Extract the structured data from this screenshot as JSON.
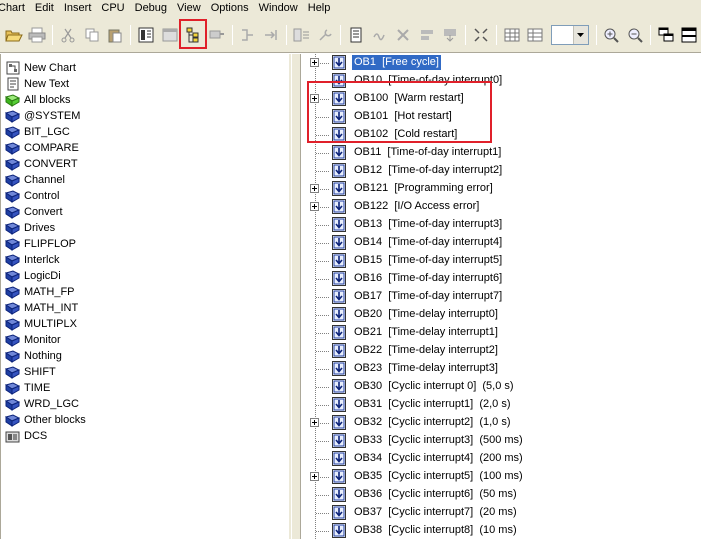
{
  "menu": [
    "Chart",
    "Edit",
    "Insert",
    "CPU",
    "Debug",
    "View",
    "Options",
    "Window",
    "Help"
  ],
  "left_tree": [
    {
      "label": "New Chart",
      "icon": "new-chart-icon"
    },
    {
      "label": "New Text",
      "icon": "new-text-icon"
    },
    {
      "label": "All blocks",
      "icon": "all-blocks-icon"
    },
    {
      "label": "@SYSTEM",
      "icon": "library-book-icon"
    },
    {
      "label": "BIT_LGC",
      "icon": "library-book-icon"
    },
    {
      "label": "COMPARE",
      "icon": "library-book-icon"
    },
    {
      "label": "CONVERT",
      "icon": "library-book-icon"
    },
    {
      "label": "Channel",
      "icon": "library-book-icon"
    },
    {
      "label": "Control",
      "icon": "library-book-icon"
    },
    {
      "label": "Convert",
      "icon": "library-book-icon"
    },
    {
      "label": "Drives",
      "icon": "library-book-icon"
    },
    {
      "label": "FLIPFLOP",
      "icon": "library-book-icon"
    },
    {
      "label": "Interlck",
      "icon": "library-book-icon"
    },
    {
      "label": "LogicDi",
      "icon": "library-book-icon"
    },
    {
      "label": "MATH_FP",
      "icon": "library-book-icon"
    },
    {
      "label": "MATH_INT",
      "icon": "library-book-icon"
    },
    {
      "label": "MULTIPLX",
      "icon": "library-book-icon"
    },
    {
      "label": "Monitor",
      "icon": "library-book-icon"
    },
    {
      "label": "Nothing",
      "icon": "library-book-icon"
    },
    {
      "label": "SHIFT",
      "icon": "library-book-icon"
    },
    {
      "label": "TIME",
      "icon": "library-book-icon"
    },
    {
      "label": "WRD_LGC",
      "icon": "library-book-icon"
    },
    {
      "label": "Other blocks",
      "icon": "library-book-icon"
    },
    {
      "label": "DCS",
      "icon": "dcs-icon"
    }
  ],
  "ob_tree": [
    {
      "label": "OB1  [Free cycle]",
      "expand": true,
      "selected": true
    },
    {
      "label": "OB10  [Time-of-day interrupt0]",
      "expand": false,
      "selected": false
    },
    {
      "label": "OB100  [Warm restart]",
      "expand": true,
      "selected": false
    },
    {
      "label": "OB101  [Hot restart]",
      "expand": false,
      "selected": false
    },
    {
      "label": "OB102  [Cold restart]",
      "expand": false,
      "selected": false
    },
    {
      "label": "OB11  [Time-of-day interrupt1]",
      "expand": false,
      "selected": false
    },
    {
      "label": "OB12  [Time-of-day interrupt2]",
      "expand": false,
      "selected": false
    },
    {
      "label": "OB121  [Programming error]",
      "expand": true,
      "selected": false
    },
    {
      "label": "OB122  [I/O Access error]",
      "expand": true,
      "selected": false
    },
    {
      "label": "OB13  [Time-of-day interrupt3]",
      "expand": false,
      "selected": false
    },
    {
      "label": "OB14  [Time-of-day interrupt4]",
      "expand": false,
      "selected": false
    },
    {
      "label": "OB15  [Time-of-day interrupt5]",
      "expand": false,
      "selected": false
    },
    {
      "label": "OB16  [Time-of-day interrupt6]",
      "expand": false,
      "selected": false
    },
    {
      "label": "OB17  [Time-of-day interrupt7]",
      "expand": false,
      "selected": false
    },
    {
      "label": "OB20  [Time-delay interrupt0]",
      "expand": false,
      "selected": false
    },
    {
      "label": "OB21  [Time-delay interrupt1]",
      "expand": false,
      "selected": false
    },
    {
      "label": "OB22  [Time-delay interrupt2]",
      "expand": false,
      "selected": false
    },
    {
      "label": "OB23  [Time-delay interrupt3]",
      "expand": false,
      "selected": false
    },
    {
      "label": "OB30  [Cyclic interrupt 0]  (5,0 s)",
      "expand": false,
      "selected": false
    },
    {
      "label": "OB31  [Cyclic interrupt1]  (2,0 s)",
      "expand": false,
      "selected": false
    },
    {
      "label": "OB32  [Cyclic interrupt2]  (1,0 s)",
      "expand": true,
      "selected": false
    },
    {
      "label": "OB33  [Cyclic interrupt3]  (500 ms)",
      "expand": false,
      "selected": false
    },
    {
      "label": "OB34  [Cyclic interrupt4]  (200 ms)",
      "expand": false,
      "selected": false
    },
    {
      "label": "OB35  [Cyclic interrupt5]  (100 ms)",
      "expand": true,
      "selected": false
    },
    {
      "label": "OB36  [Cyclic interrupt6]  (50 ms)",
      "expand": false,
      "selected": false
    },
    {
      "label": "OB37  [Cyclic interrupt7]  (20 ms)",
      "expand": false,
      "selected": false
    },
    {
      "label": "OB38  [Cyclic interrupt8]  (10 ms)",
      "expand": false,
      "selected": false
    }
  ],
  "toolbar": {
    "zoom_combo_value": ""
  },
  "colors": {
    "chrome": "#ece9d8",
    "selection": "#316ac5",
    "highlight": "#e0202a",
    "library_book": "#1f3fa3"
  }
}
